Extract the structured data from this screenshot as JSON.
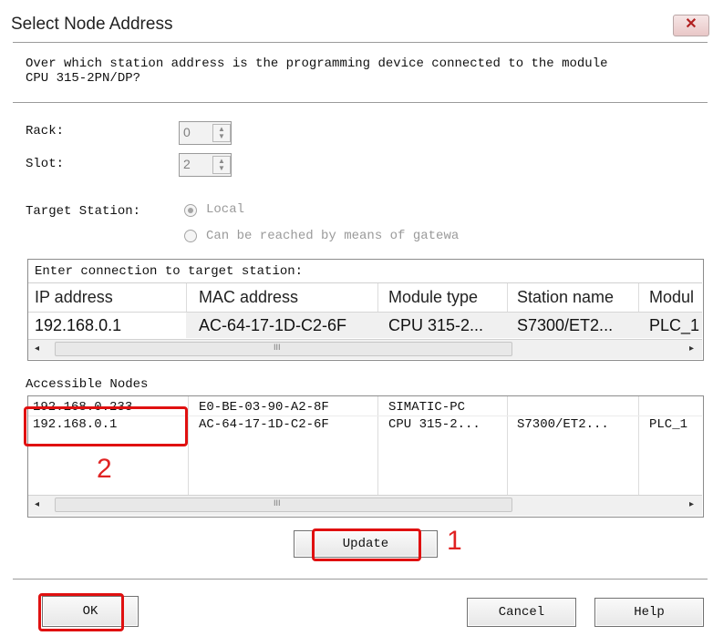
{
  "window": {
    "title": "Select Node Address",
    "close_glyph": "✕"
  },
  "prompt": {
    "line1": "Over which station address is the programming device connected to the module",
    "line2": "CPU 315-2PN/DP?"
  },
  "rack": {
    "label": "Rack:",
    "value": "0"
  },
  "slot": {
    "label": "Slot:",
    "value": "2"
  },
  "target_station": {
    "label": "Target Station:",
    "options": [
      {
        "label": "Local",
        "selected": true
      },
      {
        "label": "Can be reached by means of gatewa",
        "selected": false
      }
    ]
  },
  "connection": {
    "header": "Enter connection to target station:",
    "columns": [
      "IP address",
      "MAC address",
      "Module type",
      "Station name",
      "Modul"
    ],
    "row": [
      "192.168.0.1",
      "AC-64-17-1D-C2-6F",
      "CPU 315-2...",
      "S7300/ET2...",
      "PLC_1"
    ]
  },
  "accessible_nodes": {
    "label": "Accessible Nodes",
    "rows": [
      [
        "192.168.0.233",
        "E0-BE-03-90-A2-8F",
        "SIMATIC-PC",
        "",
        ""
      ],
      [
        "192.168.0.1",
        "AC-64-17-1D-C2-6F",
        "CPU 315-2...",
        "S7300/ET2...",
        "PLC_1"
      ]
    ]
  },
  "scrollbar": {
    "left_arrow": "◂",
    "right_arrow": "▸",
    "grip": "III"
  },
  "buttons": {
    "update": "Update",
    "ok": "OK",
    "cancel": "Cancel",
    "help": "Help"
  },
  "annotations": {
    "step1": "1",
    "step2": "2",
    "highlight_color": "#e01010"
  }
}
